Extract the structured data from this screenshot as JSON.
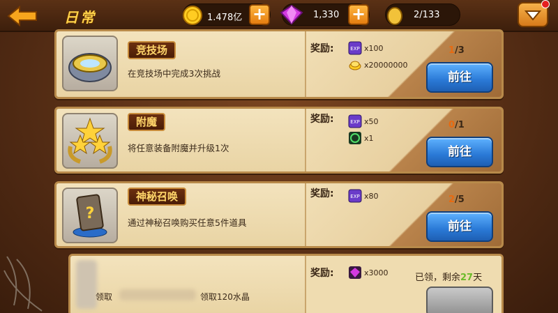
{
  "header": {
    "title": "日常",
    "gold": "1.478亿",
    "gems": "1,330",
    "stamina": "2/133"
  },
  "tasks": [
    {
      "name": "竞技场",
      "desc": "在竞技场中完成3次挑战",
      "reward_label": "奖励:",
      "rewards": [
        {
          "icon": "exp-icon",
          "qty": "x100"
        },
        {
          "icon": "gold-icon",
          "qty": "x20000000"
        }
      ],
      "progress_cur": "1",
      "progress_total": "/3",
      "button": "前往"
    },
    {
      "name": "附魔",
      "desc": "将任意装备附魔并升级1次",
      "reward_label": "奖励:",
      "rewards": [
        {
          "icon": "exp-icon",
          "qty": "x50"
        },
        {
          "icon": "ring-icon",
          "qty": "x1"
        }
      ],
      "progress_cur": "0",
      "progress_total": "/1",
      "button": "前往"
    },
    {
      "name": "神秘召唤",
      "desc": "通过神秘召唤购买任意5件道具",
      "reward_label": "奖励:",
      "rewards": [
        {
          "icon": "exp-icon",
          "qty": "x80"
        }
      ],
      "progress_cur": "2",
      "progress_total": "/5",
      "button": "前往"
    }
  ],
  "last_task": {
    "desc_a": "领取",
    "desc_b": "领取120水晶",
    "reward_label": "奖励:",
    "reward_qty": "x3000",
    "claimed_text": "已领，剩余",
    "days": "27",
    "days_unit": "天"
  },
  "colors": {
    "accent_orange": "#e86a10",
    "button_blue": "#2a79d6",
    "title_gold": "#ffd24a"
  }
}
